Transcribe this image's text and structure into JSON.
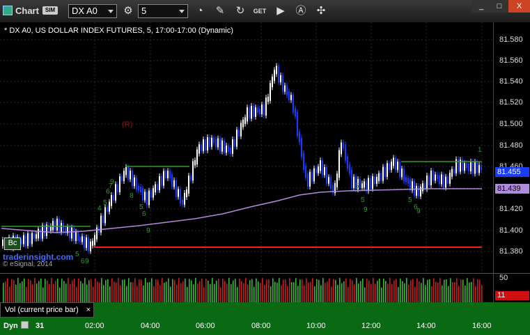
{
  "toolbar": {
    "title": "Chart",
    "sim_badge": "SIM",
    "symbol": "DX A0",
    "interval": "5",
    "icons": [
      "clock-icon",
      "pencil-icon",
      "refresh-icon",
      "get-icon",
      "play-icon",
      "alert-icon",
      "tools-icon"
    ]
  },
  "window_buttons": [
    "_",
    "□",
    "X"
  ],
  "chart": {
    "header": "* DX A0, US DOLLAR INDEX FUTURES, 5, 17:00-17:00 (Dynamic)",
    "watermark_url": "traderinsight.com",
    "watermark_copyright": "© eSignal, 2014",
    "marker_r": "(R)",
    "badge_text": "Bc",
    "last_price": "81.455",
    "ma_price": "81.439",
    "price_ticks": [
      "81.580",
      "81.560",
      "81.540",
      "81.520",
      "81.500",
      "81.480",
      "81.460",
      "81.420",
      "81.400",
      "81.380"
    ],
    "time_ticks": [
      "31",
      "02:00",
      "04:00",
      "06:00",
      "08:00",
      "10:00",
      "12:00",
      "14:00",
      "16:00"
    ],
    "setup_digits_1": [
      "9",
      "4",
      "5",
      "6",
      "7",
      "8",
      "9"
    ],
    "colors": {
      "up": "#ffffff",
      "down": "#1a3cff",
      "ma": "#b08adc",
      "support": "#ff1a1a",
      "resistance": "#2aa02a",
      "setup": "#2aa02a"
    }
  },
  "volume": {
    "label": "Vol (current price bar)",
    "close_icon": "×",
    "axis_top": "50",
    "last_value": "11"
  },
  "bottom": {
    "mode": "Dyn"
  }
}
